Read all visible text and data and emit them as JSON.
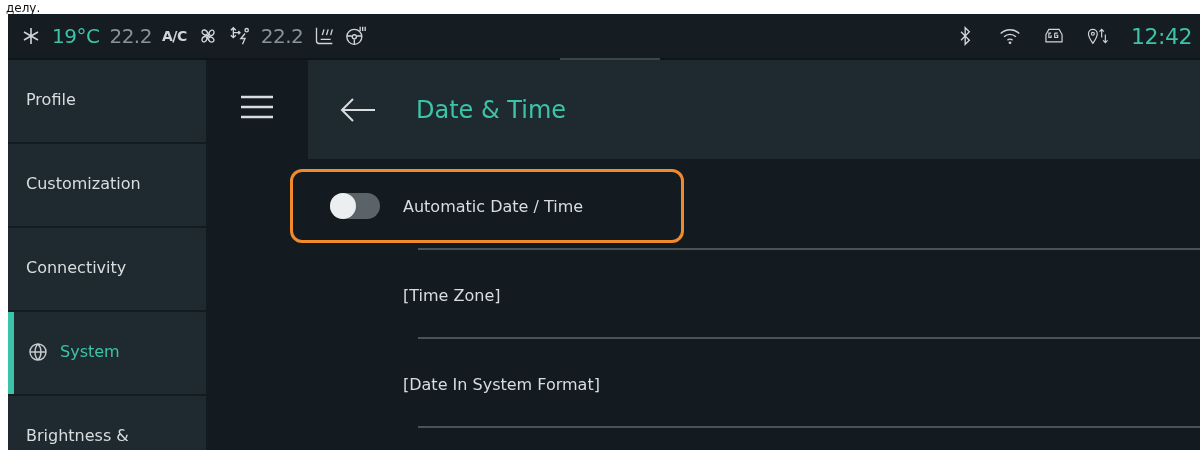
{
  "caption": {
    "text": "делу."
  },
  "status_bar": {
    "ac_on": true,
    "driver_temp": "19°C",
    "passenger_temp_1": "22.2",
    "ac_label": "A/C",
    "passenger_temp_2": "22.2",
    "time": "12:42"
  },
  "sidebar": {
    "items": [
      {
        "label": "Profile",
        "selected": false
      },
      {
        "label": "Customization",
        "selected": false
      },
      {
        "label": "Connectivity",
        "selected": false
      },
      {
        "label": "System",
        "selected": true
      },
      {
        "label": "Brightness &",
        "selected": false
      }
    ]
  },
  "header": {
    "title": "Date & Time"
  },
  "settings": [
    {
      "kind": "toggle",
      "label": "Automatic Date / Time",
      "on": false,
      "focused": true
    },
    {
      "kind": "link",
      "label": "[Time Zone]",
      "focused": false
    },
    {
      "kind": "link",
      "label": "[Date In System Format]",
      "focused": false
    }
  ]
}
